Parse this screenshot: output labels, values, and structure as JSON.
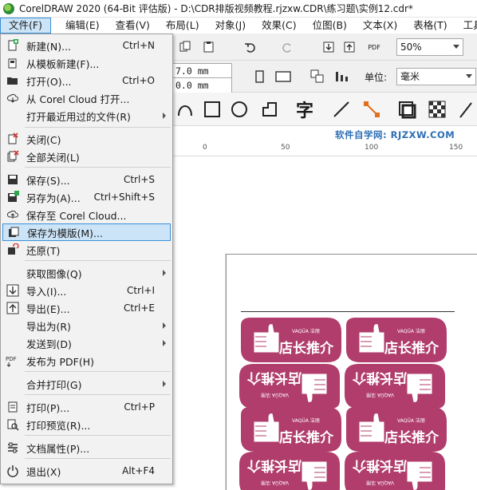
{
  "window": {
    "title": "CorelDRAW 2020 (64-Bit 评估版) - D:\\CDR排版视频教程.rjzxw.CDR\\练习题\\实例12.cdr*"
  },
  "menubar": {
    "items": [
      {
        "label": "文件(F)",
        "active": true
      },
      {
        "label": "编辑(E)"
      },
      {
        "label": "查看(V)"
      },
      {
        "label": "布局(L)"
      },
      {
        "label": "对象(J)"
      },
      {
        "label": "效果(C)"
      },
      {
        "label": "位图(B)"
      },
      {
        "label": "文本(X)"
      },
      {
        "label": "表格(T)"
      },
      {
        "label": "工具"
      }
    ]
  },
  "toolbar": {
    "zoom_value": "50%",
    "width_value": "7.0 mm",
    "height_value": "0.0 mm",
    "units_label": "单位:",
    "units_value": "毫米",
    "pdf_label": "PDF"
  },
  "ruler": {
    "ticks": [
      "0",
      "50",
      "100",
      "150"
    ]
  },
  "banner": {
    "text": "软件自学网: RJZXW.COM"
  },
  "stickers": {
    "text": "店长推介",
    "brand": "VAQÜA 洁丽",
    "color": "#b03d6b"
  },
  "file_menu": {
    "items": [
      {
        "label": "新建(N)...",
        "shortcut": "Ctrl+N",
        "icon": "new-document-icon"
      },
      {
        "label": "从模板新建(F)...",
        "shortcut": "",
        "icon": "new-from-template-icon"
      },
      {
        "label": "打开(O)...",
        "shortcut": "Ctrl+O",
        "icon": "open-folder-icon"
      },
      {
        "label": "从 Corel Cloud 打开...",
        "shortcut": "",
        "icon": "cloud-download-icon"
      },
      {
        "label": "打开最近用过的文件(R)",
        "shortcut": "",
        "icon": "",
        "submenu": true
      },
      {
        "label": "关闭(C)",
        "shortcut": "",
        "icon": "close-document-icon"
      },
      {
        "label": "全部关闭(L)",
        "shortcut": "",
        "icon": "close-all-icon"
      },
      {
        "label": "保存(S)...",
        "shortcut": "Ctrl+S",
        "icon": "save-icon"
      },
      {
        "label": "另存为(A)...",
        "shortcut": "Ctrl+Shift+S",
        "icon": "save-as-icon"
      },
      {
        "label": "保存至 Corel Cloud...",
        "shortcut": "",
        "icon": "cloud-upload-icon"
      },
      {
        "label": "保存为模版(M)...",
        "shortcut": "",
        "icon": "save-as-template-icon",
        "highlight": true
      },
      {
        "label": "还原(T)",
        "shortcut": "",
        "icon": "revert-icon"
      },
      {
        "label": "获取图像(Q)",
        "shortcut": "",
        "icon": "",
        "submenu": true
      },
      {
        "label": "导入(I)...",
        "shortcut": "Ctrl+I",
        "icon": "import-icon"
      },
      {
        "label": "导出(E)...",
        "shortcut": "Ctrl+E",
        "icon": "export-icon"
      },
      {
        "label": "导出为(R)",
        "shortcut": "",
        "icon": "",
        "submenu": true
      },
      {
        "label": "发送到(D)",
        "shortcut": "",
        "icon": "",
        "submenu": true
      },
      {
        "label": "发布为 PDF(H)",
        "shortcut": "",
        "icon": "pdf-icon"
      },
      {
        "label": "合并打印(G)",
        "shortcut": "",
        "icon": "",
        "submenu": true
      },
      {
        "label": "打印(P)...",
        "shortcut": "Ctrl+P",
        "icon": "print-icon"
      },
      {
        "label": "打印预览(R)...",
        "shortcut": "",
        "icon": "print-preview-icon"
      },
      {
        "label": "文档属性(P)...",
        "shortcut": "",
        "icon": "document-properties-icon"
      },
      {
        "label": "退出(X)",
        "shortcut": "Alt+F4",
        "icon": "exit-icon"
      }
    ]
  }
}
